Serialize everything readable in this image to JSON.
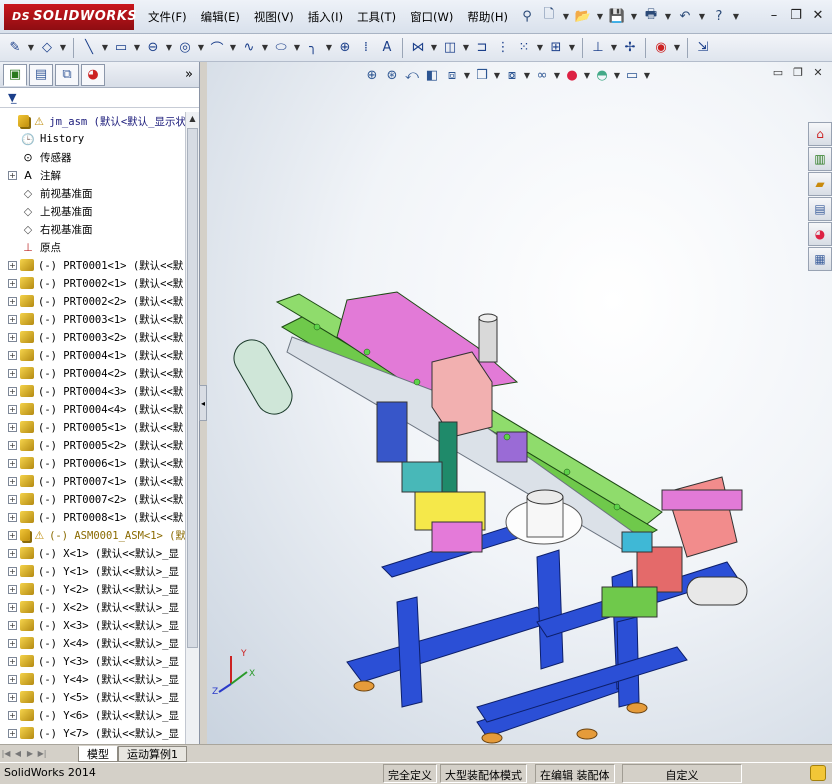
{
  "app": {
    "logo": "SOLIDWORKS",
    "logo_prefix": "DS"
  },
  "menu": [
    "文件(F)",
    "编辑(E)",
    "视图(V)",
    "插入(I)",
    "工具(T)",
    "窗口(W)",
    "帮助(H)"
  ],
  "title_tools": [
    "pin-icon",
    "new-document-icon",
    "open-icon",
    "save-icon",
    "print-icon",
    "undo-icon",
    "help-icon"
  ],
  "window_controls": [
    "minimize-icon",
    "restore-icon",
    "close-icon"
  ],
  "sketch_tools": [
    "smart-dimension-icon",
    "sketch-icon",
    "line-icon",
    "rectangle-icon",
    "slot-icon",
    "circle-icon",
    "arc-icon",
    "spline-icon",
    "ellipse-icon",
    "fillet-icon",
    "point-icon",
    "centerline-icon",
    "text-icon",
    "trim-icon",
    "convert-entities-icon",
    "offset-icon",
    "mirror-icon",
    "linear-pattern-icon",
    "move-entities-icon",
    "display-relations-icon",
    "repair-sketch-icon",
    "quick-snaps-icon",
    "rapid-sketch-icon",
    "instant3d-icon"
  ],
  "fm_tabs": [
    "feature-manager-tab",
    "property-manager-tab",
    "configuration-manager-tab",
    "display-manager-tab"
  ],
  "tree": {
    "root_label": "jm_asm  (默认<默认_显示状",
    "items": [
      {
        "icon": "history",
        "label": "History",
        "expandable": false
      },
      {
        "icon": "sensor",
        "label": "传感器",
        "expandable": false
      },
      {
        "icon": "annotation",
        "label": "注解",
        "expandable": true
      },
      {
        "icon": "plane",
        "label": "前视基准面",
        "expandable": false
      },
      {
        "icon": "plane",
        "label": "上视基准面",
        "expandable": false
      },
      {
        "icon": "plane",
        "label": "右视基准面",
        "expandable": false
      },
      {
        "icon": "origin",
        "label": "原点",
        "expandable": false
      },
      {
        "icon": "part",
        "label": "(-) PRT0001<1> (默认<<默",
        "expandable": true
      },
      {
        "icon": "part",
        "label": "(-) PRT0002<1> (默认<<默",
        "expandable": true
      },
      {
        "icon": "part",
        "label": "(-) PRT0002<2> (默认<<默",
        "expandable": true
      },
      {
        "icon": "part",
        "label": "(-) PRT0003<1> (默认<<默",
        "expandable": true
      },
      {
        "icon": "part",
        "label": "(-) PRT0003<2> (默认<<默",
        "expandable": true
      },
      {
        "icon": "part",
        "label": "(-) PRT0004<1> (默认<<默",
        "expandable": true
      },
      {
        "icon": "part",
        "label": "(-) PRT0004<2> (默认<<默",
        "expandable": true
      },
      {
        "icon": "part",
        "label": "(-) PRT0004<3> (默认<<默",
        "expandable": true
      },
      {
        "icon": "part",
        "label": "(-) PRT0004<4> (默认<<默",
        "expandable": true
      },
      {
        "icon": "part",
        "label": "(-) PRT0005<1> (默认<<默",
        "expandable": true
      },
      {
        "icon": "part",
        "label": "(-) PRT0005<2> (默认<<默",
        "expandable": true
      },
      {
        "icon": "part",
        "label": "(-) PRT0006<1> (默认<<默",
        "expandable": true
      },
      {
        "icon": "part",
        "label": "(-) PRT0007<1> (默认<<默",
        "expandable": true
      },
      {
        "icon": "part",
        "label": "(-) PRT0007<2> (默认<<默",
        "expandable": true
      },
      {
        "icon": "part",
        "label": "(-) PRT0008<1> (默认<<默",
        "expandable": true
      },
      {
        "icon": "asm-warn",
        "label": "(-) ASM0001_ASM<1> (默",
        "expandable": true
      },
      {
        "icon": "part",
        "label": "(-) X<1> (默认<<默认>_显",
        "expandable": true
      },
      {
        "icon": "part",
        "label": "(-) Y<1> (默认<<默认>_显",
        "expandable": true
      },
      {
        "icon": "part",
        "label": "(-) Y<2> (默认<<默认>_显",
        "expandable": true
      },
      {
        "icon": "part",
        "label": "(-) X<2> (默认<<默认>_显",
        "expandable": true
      },
      {
        "icon": "part",
        "label": "(-) X<3> (默认<<默认>_显",
        "expandable": true
      },
      {
        "icon": "part",
        "label": "(-) X<4> (默认<<默认>_显",
        "expandable": true
      },
      {
        "icon": "part",
        "label": "(-) Y<3> (默认<<默认>_显",
        "expandable": true
      },
      {
        "icon": "part",
        "label": "(-) Y<4> (默认<<默认>_显",
        "expandable": true
      },
      {
        "icon": "part",
        "label": "(-) Y<5> (默认<<默认>_显",
        "expandable": true
      },
      {
        "icon": "part",
        "label": "(-) Y<6> (默认<<默认>_显",
        "expandable": true
      },
      {
        "icon": "part",
        "label": "(-) Y<7> (默认<<默认>_显",
        "expandable": true
      }
    ]
  },
  "bottom_tabs": [
    "模型",
    "运动算例1"
  ],
  "status": {
    "app_version": "SolidWorks 2014",
    "state": "完全定义",
    "mode": "大型装配体模式",
    "editing": "在编辑 装配体",
    "units": "自定义"
  },
  "heads_up_tools": [
    "zoom-to-fit-icon",
    "zoom-to-area-icon",
    "previous-view-icon",
    "section-view-icon",
    "dynamic-annotation-icon",
    "view-orientation-icon",
    "display-style-icon",
    "hide-show-items-icon",
    "edit-appearance-icon",
    "apply-scene-icon",
    "view-settings-icon"
  ],
  "task_pane": [
    "solidworks-resources-icon",
    "design-library-icon",
    "file-explorer-icon",
    "view-palette-icon",
    "appearances-icon",
    "custom-properties-icon"
  ],
  "triad": {
    "x": "X",
    "y": "Y",
    "z": "Z"
  },
  "colors": {
    "frame_blue": "#2b4fd6",
    "conveyor_green": "#7ddb5a",
    "magenta": "#e278d6",
    "salmon": "#f0a3a3",
    "logo_red": "#c9161c"
  }
}
